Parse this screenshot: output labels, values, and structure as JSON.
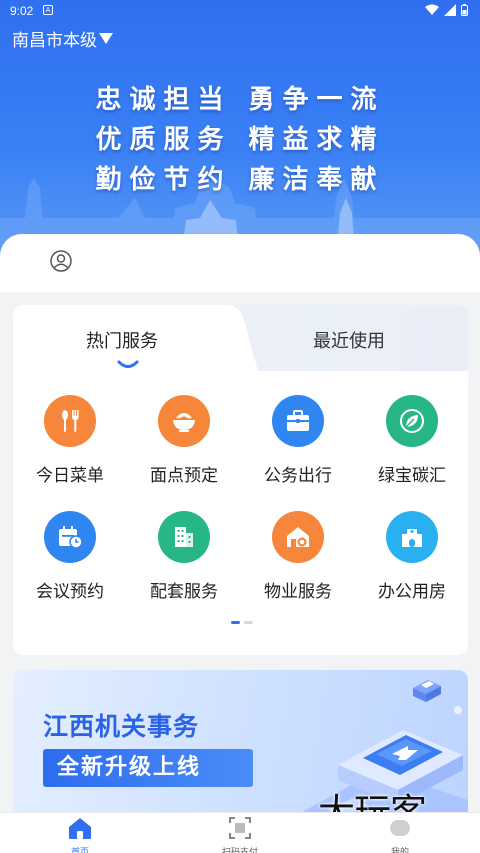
{
  "status_bar": {
    "time": "9:02",
    "notification_glyph": "A"
  },
  "header": {
    "city_label": "南昌市本级"
  },
  "hero": {
    "slogan_lines": [
      "忠诚担当 勇争一流",
      "优质服务 精益求精",
      "勤俭节约 廉洁奉献"
    ]
  },
  "services_card": {
    "tabs": [
      {
        "label": "热门服务",
        "active": true
      },
      {
        "label": "最近使用",
        "active": false
      }
    ],
    "items": [
      {
        "label": "今日菜单",
        "icon": "utensils-icon",
        "color": "#f5863a"
      },
      {
        "label": "面点预定",
        "icon": "bowl-icon",
        "color": "#f5863a"
      },
      {
        "label": "公务出行",
        "icon": "briefcase-icon",
        "color": "#2f86f0"
      },
      {
        "label": "绿宝碳汇",
        "icon": "leaf-icon",
        "color": "#27b685"
      },
      {
        "label": "会议预约",
        "icon": "calendar-clock-icon",
        "color": "#2f86f0"
      },
      {
        "label": "配套服务",
        "icon": "buildings-icon",
        "color": "#27b685"
      },
      {
        "label": "物业服务",
        "icon": "house-gear-icon",
        "color": "#f5863a"
      },
      {
        "label": "办公用房",
        "icon": "office-building-icon",
        "color": "#29b0f0"
      }
    ],
    "pager": {
      "pages": 2,
      "current": 1
    }
  },
  "banner": {
    "title": "江西机关事务",
    "subtitle": "全新升级上线"
  },
  "watermark": "大玩客",
  "bottom_nav": {
    "items": [
      {
        "label": "首页",
        "icon": "home-icon",
        "active": true
      },
      {
        "label": "扫码支付",
        "icon": "scan-icon",
        "active": false
      },
      {
        "label": "我的",
        "icon": "profile-icon",
        "active": false
      }
    ]
  },
  "colors": {
    "primary": "#2f6ff0",
    "orange": "#f5863a",
    "green": "#27b685"
  }
}
